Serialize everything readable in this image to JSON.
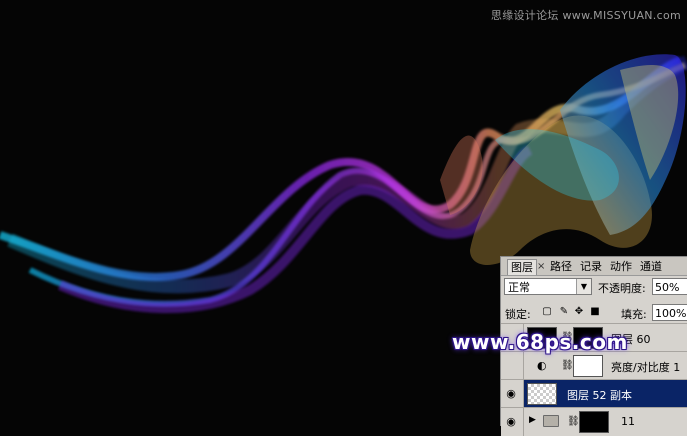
{
  "watermark_top": "思缘设计论坛 www.MISSYUAN.com",
  "watermark_68ps": "www.68ps.com",
  "panel": {
    "tabs": [
      {
        "label": "图层",
        "active": true
      },
      {
        "label": "路径",
        "active": false
      },
      {
        "label": "记录",
        "active": false
      },
      {
        "label": "动作",
        "active": false
      },
      {
        "label": "通道",
        "active": false
      }
    ],
    "tab_close": "×",
    "blend_mode": "正常",
    "opacity_label": "不透明度:",
    "opacity_value": "50%",
    "lock_label": "锁定:",
    "fill_label": "填充:",
    "fill_value": "100%",
    "layers": [
      {
        "name": "图层 60",
        "visible": false,
        "selected": false,
        "kind": "mask-black"
      },
      {
        "name": "亮度/对比度 1",
        "visible": false,
        "selected": false,
        "kind": "adjustment"
      },
      {
        "name": "图层 52 副本",
        "visible": true,
        "selected": true,
        "kind": "transparent"
      },
      {
        "name": "11",
        "visible": true,
        "selected": false,
        "kind": "group"
      }
    ]
  },
  "colors": {
    "background": "#050505",
    "panel": "#d6d3ce",
    "selection": "#0a2466"
  }
}
